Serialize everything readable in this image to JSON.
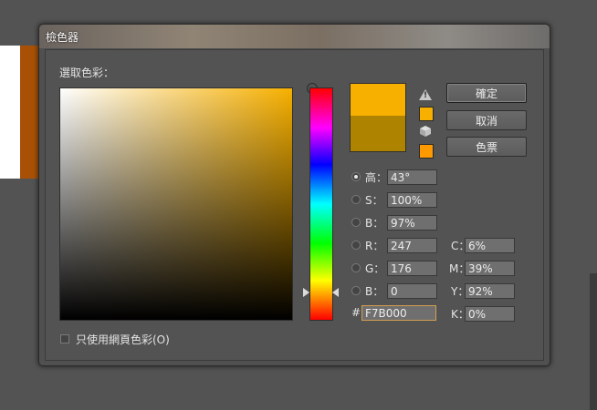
{
  "window": {
    "title": "檢色器"
  },
  "picker": {
    "select_label": "選取色彩："
  },
  "colors": {
    "new": "#f7b000",
    "old": "#ad8300",
    "web_safe": "#ff9900"
  },
  "icons": {
    "gamut_warning": "warning-triangle-icon",
    "web_warning": "cube-icon"
  },
  "buttons": {
    "ok": "確定",
    "cancel": "取消",
    "swatches": "色票"
  },
  "hsb": [
    {
      "label": "高：",
      "value": "43°",
      "selected": true
    },
    {
      "label": "S：",
      "value": "100%",
      "selected": false
    },
    {
      "label": "B：",
      "value": "97%",
      "selected": false
    }
  ],
  "rgb": [
    {
      "label": "R：",
      "value": "247",
      "selected": false
    },
    {
      "label": "G：",
      "value": "176",
      "selected": false
    },
    {
      "label": "B：",
      "value": "0",
      "selected": false
    }
  ],
  "hex": {
    "label": "#",
    "value": "F7B000"
  },
  "cmyk": [
    {
      "label": "C：",
      "value": "6%"
    },
    {
      "label": "M：",
      "value": "39%"
    },
    {
      "label": "Y：",
      "value": "92%"
    },
    {
      "label": "K：",
      "value": "0%"
    }
  ],
  "web_only": {
    "label": "只使用網頁色彩(O)",
    "checked": false
  }
}
